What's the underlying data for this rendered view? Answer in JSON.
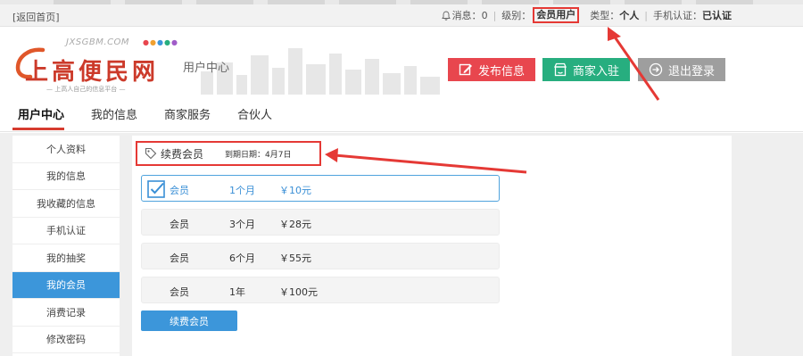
{
  "topbar": {
    "back_link": "[返回首页]",
    "message_label": "消息：",
    "message_count": "0",
    "level_label": "级别：",
    "level_value": "会员用户",
    "type_label": "类型：",
    "type_value": "个人",
    "phone_label": "手机认证：",
    "phone_value": "已认证"
  },
  "header": {
    "logo_domain": "JXSGBM.COM",
    "logo_name": "上高便民网",
    "logo_slogan": "— 上高人自己的信息平台 —",
    "subtitle": "用户中心",
    "publish_button": "发布信息",
    "merchant_button": "商家入驻",
    "logout_button": "退出登录"
  },
  "nav": {
    "tabs": [
      "用户中心",
      "我的信息",
      "商家服务",
      "合伙人"
    ],
    "active_tab": "用户中心"
  },
  "sidebar": {
    "items": [
      "个人资料",
      "我的信息",
      "我收藏的信息",
      "手机认证",
      "我的抽奖",
      "我的会员",
      "消费记录",
      "修改密码"
    ],
    "active_item": "我的会员"
  },
  "main": {
    "section_title": "续费会员",
    "expiry_text": "到期日期：4月7日",
    "plans": [
      {
        "name": "会员",
        "duration": "1个月",
        "price": "￥10元",
        "selected": true
      },
      {
        "name": "会员",
        "duration": "3个月",
        "price": "￥28元",
        "selected": false
      },
      {
        "name": "会员",
        "duration": "6个月",
        "price": "￥55元",
        "selected": false
      },
      {
        "name": "会员",
        "duration": "1年",
        "price": "￥100元",
        "selected": false
      }
    ],
    "renew_button": "续费会员"
  },
  "colors": {
    "accent_blue": "#3c96da",
    "publish_red": "#e8464e",
    "merchant_green": "#27ae7f",
    "logout_gray": "#9e9e9e",
    "annotation_red": "#e53935"
  }
}
